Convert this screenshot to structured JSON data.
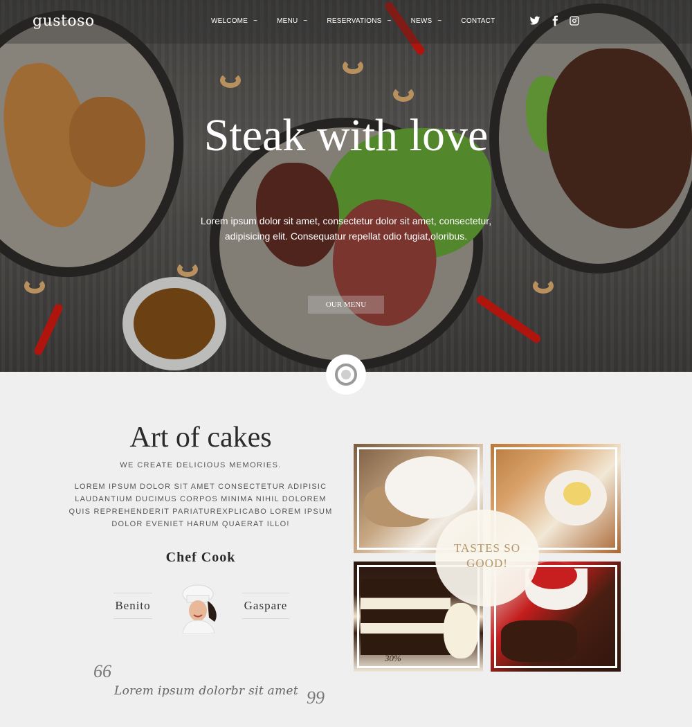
{
  "nav": {
    "logo": "gustoso",
    "items": [
      {
        "label": "WELCOME",
        "dropdown": true
      },
      {
        "label": "MENU",
        "dropdown": true
      },
      {
        "label": "RESERVATIONS",
        "dropdown": true
      },
      {
        "label": "NEWS",
        "dropdown": true
      },
      {
        "label": "CONTACT",
        "dropdown": false
      }
    ],
    "dropdown_glyph": "~",
    "social": [
      "twitter-icon",
      "facebook-icon",
      "instagram-icon"
    ]
  },
  "hero": {
    "title": "Steak with love",
    "text": "Lorem ipsum dolor sit amet, consectetur dolor sit amet, consectetur, adipisicing elit. Consequatur repellat odio fugiat,oloribus.",
    "button": "OUR MENU"
  },
  "about": {
    "title": "Art of cakes",
    "subtitle": "WE CREATE DELICIOUS MEMORIES.",
    "text": "LOREM IPSUM DOLOR SIT AMET CONSECTETUR ADIPISIC LAUDANTIUM DUCIMUS CORPOS MINIMA NIHIL DOLOREM QUIS REPREHENDERIT PARIATUREXPLICABO LOREM IPSUM DOLOR EVENIET HARUM QUAERAT ILLO!",
    "chef_heading": "Chef Cook",
    "chef_first": "Benito",
    "chef_last": "Gaspare",
    "quote_open": "66",
    "quote_text": "Lorem ipsum dolorbr sit amet",
    "quote_close": "99"
  },
  "collage": {
    "badge_line1": "TASTES SO",
    "badge_line2": "GOOD!",
    "cake_label": "30%"
  },
  "colors": {
    "badge_text": "#b79566",
    "background": "#efefef",
    "heading": "#2b2b2b"
  }
}
